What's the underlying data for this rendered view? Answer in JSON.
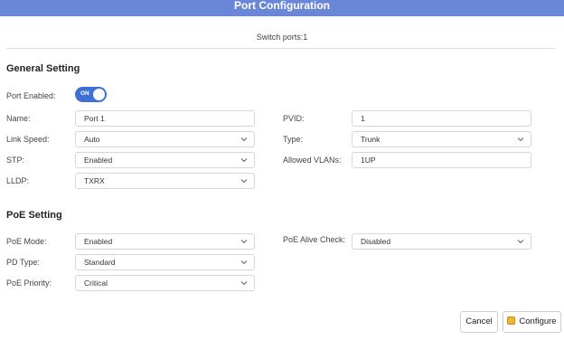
{
  "dialog": {
    "title": "Port Configuration",
    "subtitle": "Switch ports:1"
  },
  "general": {
    "title": "General Setting",
    "port_enabled": {
      "label": "Port Enabled:",
      "toggle_text": "ON",
      "state": true
    },
    "name": {
      "label": "Name:",
      "value": "Port 1"
    },
    "pvid": {
      "label": "PVID:",
      "value": "1"
    },
    "link_speed": {
      "label": "Link Speed:",
      "value": "Auto"
    },
    "type": {
      "label": "Type:",
      "value": "Trunk"
    },
    "stp": {
      "label": "STP:",
      "value": "Enabled"
    },
    "allowed_vlans": {
      "label": "Allowed VLANs:",
      "value": "1UP"
    },
    "lldp": {
      "label": "LLDP:",
      "value": "TXRX"
    }
  },
  "poe": {
    "title": "PoE Setting",
    "mode": {
      "label": "PoE Mode:",
      "value": "Enabled"
    },
    "alive_check": {
      "label": "PoE Alive Check:",
      "value": "Disabled"
    },
    "pd_type": {
      "label": "PD Type:",
      "value": "Standard"
    },
    "priority": {
      "label": "PoE Priority:",
      "value": "Critical"
    }
  },
  "footer": {
    "cancel_label": "Cancel",
    "configure_label": "Configure"
  },
  "colors": {
    "titlebar": "#6a87d7",
    "toggle_on": "#3f6fd6",
    "configure_icon": "#f2b531"
  },
  "icons": {
    "dropdown": "chevron-down-icon",
    "configure": "configure-icon"
  }
}
